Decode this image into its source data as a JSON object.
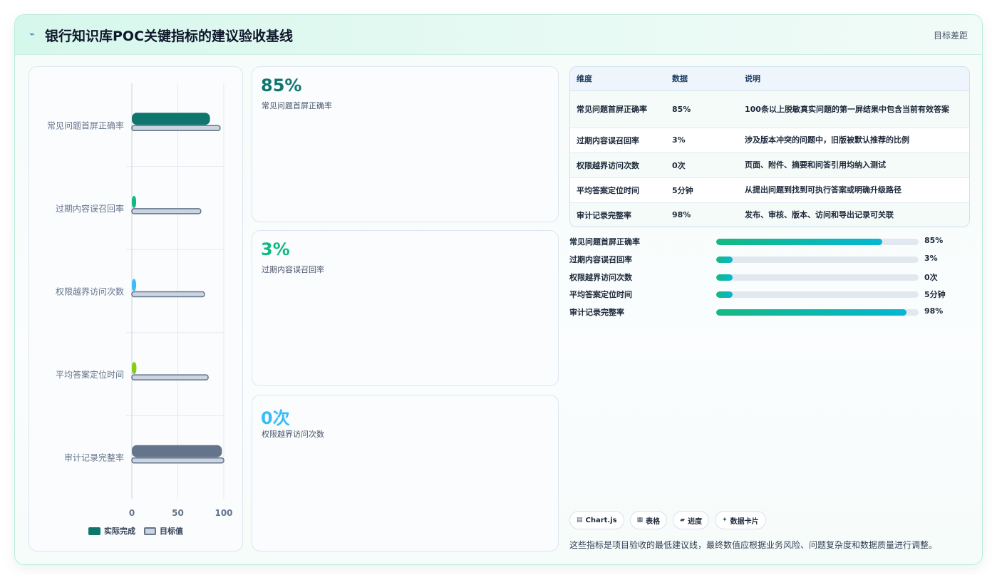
{
  "header": {
    "icon": "chart-line-icon",
    "title": "银行知识库POC关键指标的建议验收基线",
    "link_label": "目标差距"
  },
  "chart_data": {
    "type": "bar",
    "orientation": "horizontal",
    "categories": [
      "常见问题首屏正确率",
      "过期内容误召回率",
      "权限越界访问次数",
      "平均答案定位时间",
      "审计记录完整率"
    ],
    "series": [
      {
        "name": "实际完成",
        "values": [
          85,
          3,
          0,
          5,
          98
        ],
        "colors": [
          "#0f766e",
          "#10b981",
          "#38bdf8",
          "#84cc16",
          "#64748b"
        ]
      },
      {
        "name": "目标值",
        "values": [
          96,
          75,
          79,
          83,
          100
        ],
        "color": "#cbd5e1"
      }
    ],
    "xlim": [
      0,
      100
    ],
    "xticks": [
      "0",
      "50",
      "100"
    ],
    "grid": true,
    "legend_position": "bottom"
  },
  "kpis": [
    {
      "value": "85%",
      "label": "常见问题首屏正确率",
      "color": "#0f766e"
    },
    {
      "value": "3%",
      "label": "过期内容误召回率",
      "color": "#10b981"
    },
    {
      "value": "0次",
      "label": "权限越界访问次数",
      "color": "#38bdf8"
    }
  ],
  "table": {
    "headers": [
      "维度",
      "数据",
      "说明"
    ],
    "rows": [
      [
        "常见问题首屏正确率",
        "85%",
        "100条以上脱敏真实问题的第一屏结果中包含当前有效答案"
      ],
      [
        "过期内容误召回率",
        "3%",
        "涉及版本冲突的问题中，旧版被默认推荐的比例"
      ],
      [
        "权限越界访问次数",
        "0次",
        "页面、附件、摘要和问答引用均纳入测试"
      ],
      [
        "平均答案定位时间",
        "5分钟",
        "从提出问题到找到可执行答案或明确升级路径"
      ],
      [
        "审计记录完整率",
        "98%",
        "发布、审核、版本、访问和导出记录可关联"
      ]
    ]
  },
  "progress": [
    {
      "label": "常见问题首屏正确率",
      "value": "85%",
      "fraction": 0.82
    },
    {
      "label": "过期内容误召回率",
      "value": "3%",
      "fraction": 0.08
    },
    {
      "label": "权限越界访问次数",
      "value": "0次",
      "fraction": 0.08
    },
    {
      "label": "平均答案定位时间",
      "value": "5分钟",
      "fraction": 0.08
    },
    {
      "label": "审计记录完整率",
      "value": "98%",
      "fraction": 0.94
    }
  ],
  "chips": [
    {
      "icon": "chart-icon",
      "glyph": "▤",
      "label": "Chart.js"
    },
    {
      "icon": "table-icon",
      "glyph": "▦",
      "label": "表格"
    },
    {
      "icon": "progress-icon",
      "glyph": "▰",
      "label": "进度"
    },
    {
      "icon": "sparkle-icon",
      "glyph": "✦",
      "label": "数据卡片"
    }
  ],
  "footnote": "这些指标是项目验收的最低建议线，最终数值应根据业务风险、问题复杂度和数据质量进行调整。"
}
